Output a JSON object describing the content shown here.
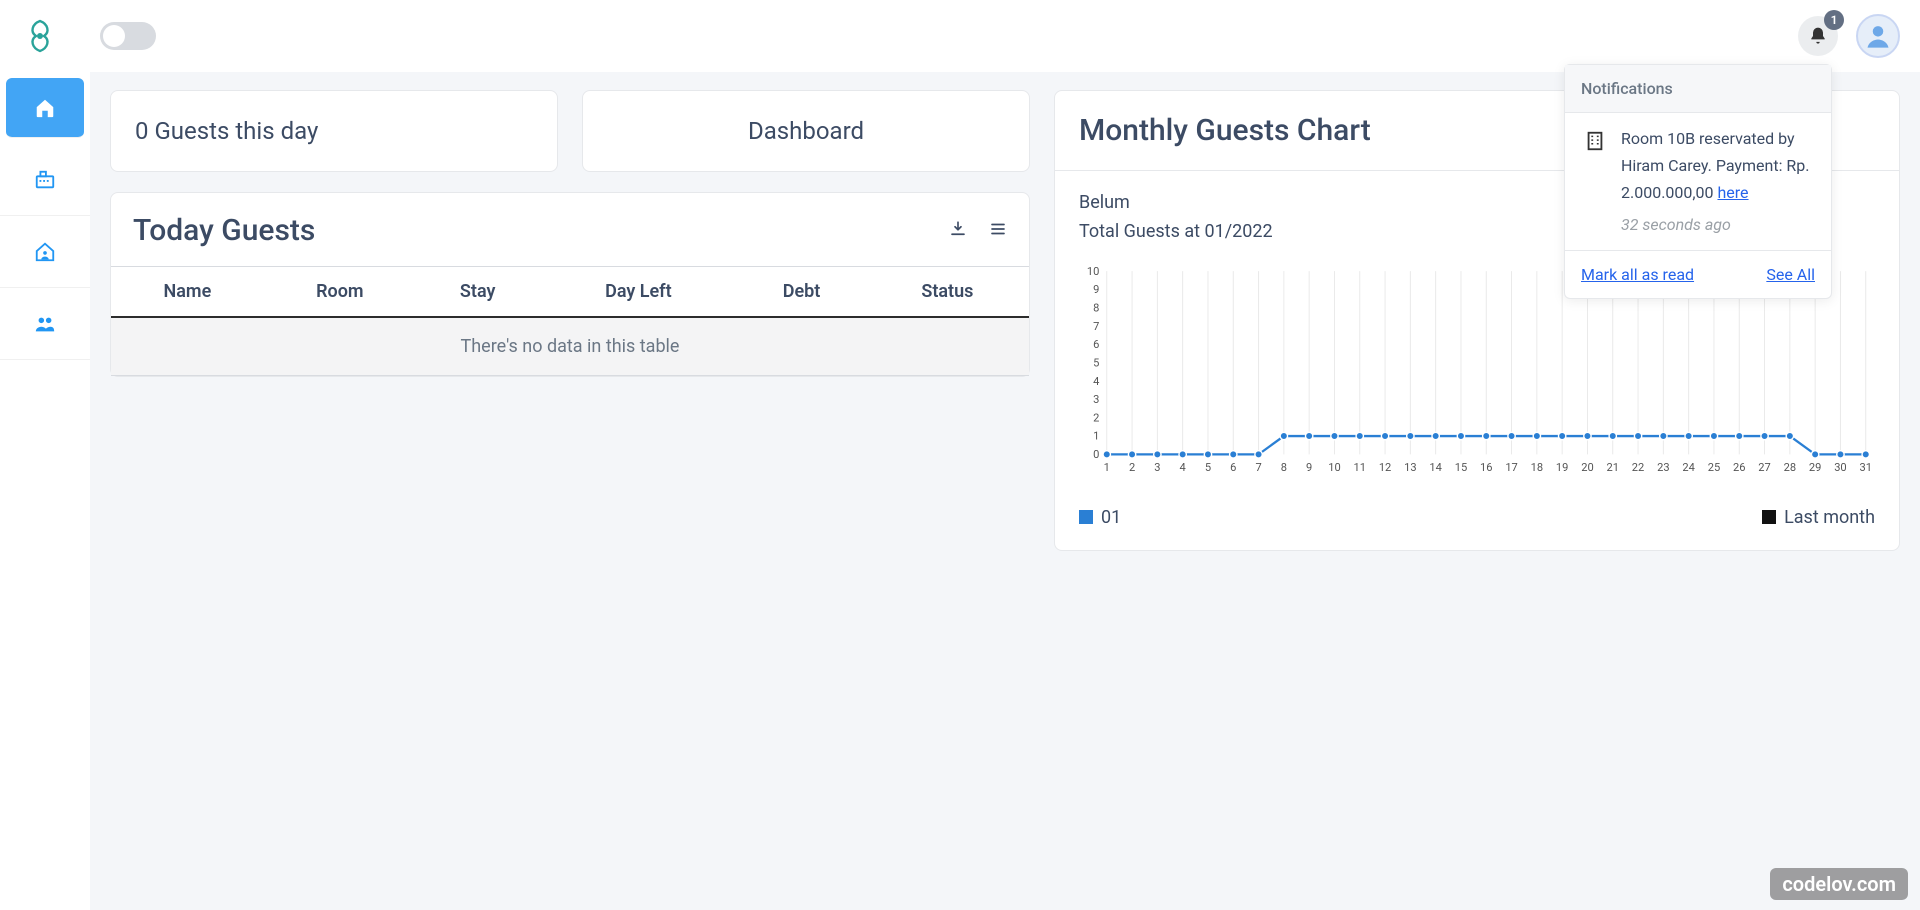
{
  "header": {
    "notification_count": "1"
  },
  "sidebar": {
    "items": [
      "home",
      "cash-register",
      "house-user",
      "users"
    ]
  },
  "stats": {
    "guests_today": "0 Guests this day",
    "page_title": "Dashboard"
  },
  "today_guests": {
    "title": "Today Guests",
    "columns": [
      "Name",
      "Room",
      "Stay",
      "Day Left",
      "Debt",
      "Status"
    ],
    "empty_message": "There's no data in this table"
  },
  "chart_card": {
    "title": "Monthly Guests Chart",
    "sub1": "Belum",
    "sub2": "Total Guests at 01/2022",
    "legend_current": "01",
    "legend_last": "Last month"
  },
  "chart_data": {
    "type": "line",
    "title": "Monthly Guests Chart",
    "xlabel": "",
    "ylabel": "",
    "ylim": [
      0,
      10
    ],
    "x": [
      1,
      2,
      3,
      4,
      5,
      6,
      7,
      8,
      9,
      10,
      11,
      12,
      13,
      14,
      15,
      16,
      17,
      18,
      19,
      20,
      21,
      22,
      23,
      24,
      25,
      26,
      27,
      28,
      29,
      30,
      31
    ],
    "series": [
      {
        "name": "01",
        "values": [
          0,
          0,
          0,
          0,
          0,
          0,
          0,
          1,
          1,
          1,
          1,
          1,
          1,
          1,
          1,
          1,
          1,
          1,
          1,
          1,
          1,
          1,
          1,
          1,
          1,
          1,
          1,
          1,
          0,
          0,
          0
        ]
      }
    ],
    "legend": [
      "01",
      "Last month"
    ],
    "y_ticks": [
      0,
      1,
      2,
      3,
      4,
      5,
      6,
      7,
      8,
      9,
      10
    ]
  },
  "notifications": {
    "header": "Notifications",
    "item": {
      "text_prefix": "Room 10B reservated by Hiram Carey. Payment: Rp. 2.000.000,00 ",
      "link": "here",
      "time": "32 seconds ago"
    },
    "mark_all": "Mark all as read",
    "see_all": "See All"
  },
  "watermark": "codelov.com"
}
